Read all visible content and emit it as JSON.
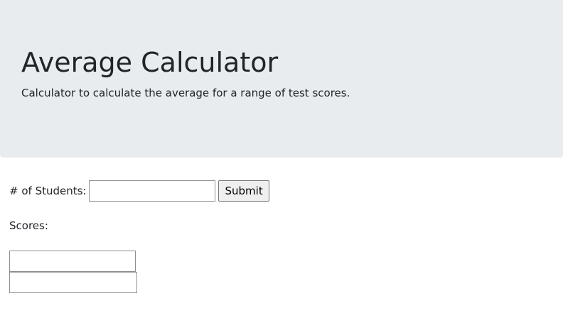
{
  "header": {
    "title": "Average Calculator",
    "subtitle": "Calculator to calculate the average for a range of test scores."
  },
  "form": {
    "students_label": "# of Students:",
    "students_value": "",
    "submit_label": "Submit",
    "scores_label": "Scores:",
    "score_inputs": [
      {
        "value": ""
      },
      {
        "value": ""
      }
    ]
  },
  "colors": {
    "header_background": "#e9ecef",
    "text": "#212529"
  }
}
